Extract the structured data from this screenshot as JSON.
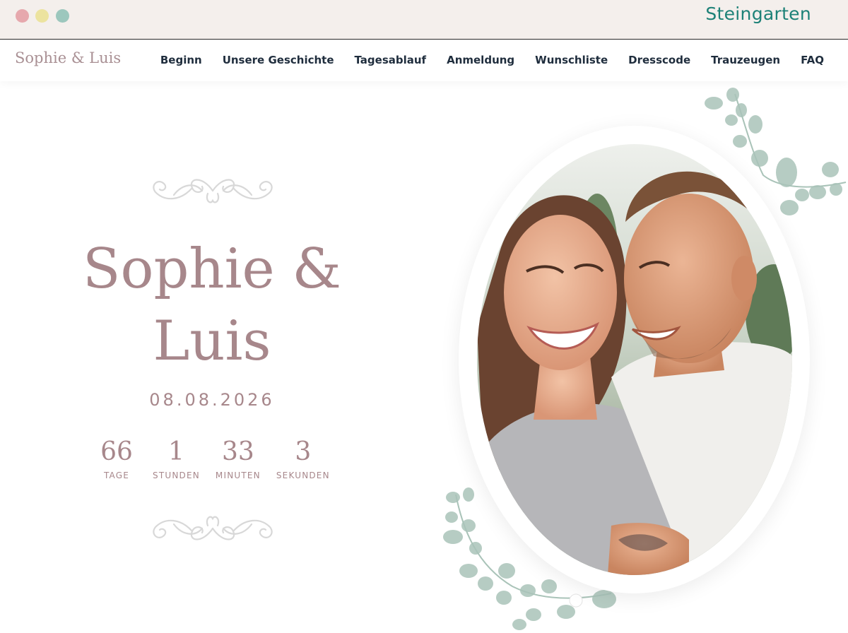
{
  "window": {
    "brand": "Steingarten",
    "controls": [
      {
        "name": "close",
        "color": "#e6a8ad"
      },
      {
        "name": "minimize",
        "color": "#ece39f"
      },
      {
        "name": "maximize",
        "color": "#9cc7bd"
      }
    ]
  },
  "site": {
    "logo": "Sophie & Luis",
    "nav": [
      {
        "label": "Beginn"
      },
      {
        "label": "Unsere Geschichte"
      },
      {
        "label": "Tagesablauf"
      },
      {
        "label": "Anmeldung"
      },
      {
        "label": "Wunschliste"
      },
      {
        "label": "Dresscode"
      },
      {
        "label": "Trauzeugen"
      },
      {
        "label": "FAQ"
      }
    ]
  },
  "hero": {
    "title_line1": "Sophie &",
    "title_line2": "Luis",
    "date": "08.08.2026",
    "countdown": [
      {
        "value": "66",
        "label": "TAGE"
      },
      {
        "value": "1",
        "label": "STUNDEN"
      },
      {
        "value": "33",
        "label": "MINUTEN"
      },
      {
        "value": "3",
        "label": "SEKUNDEN"
      }
    ],
    "ornament_icon": "flourish-ornament-icon",
    "leaves_icon": "eucalyptus-branch-icon"
  },
  "colors": {
    "chrome_bg": "#f4efec",
    "brand_teal": "#1d8177",
    "nav_text": "#1f2d3d",
    "accent_mauve": "#a7878b",
    "logo_mauve": "#a99094",
    "ornament": "#d8d8d8",
    "leaf": "#a9c3b8"
  }
}
